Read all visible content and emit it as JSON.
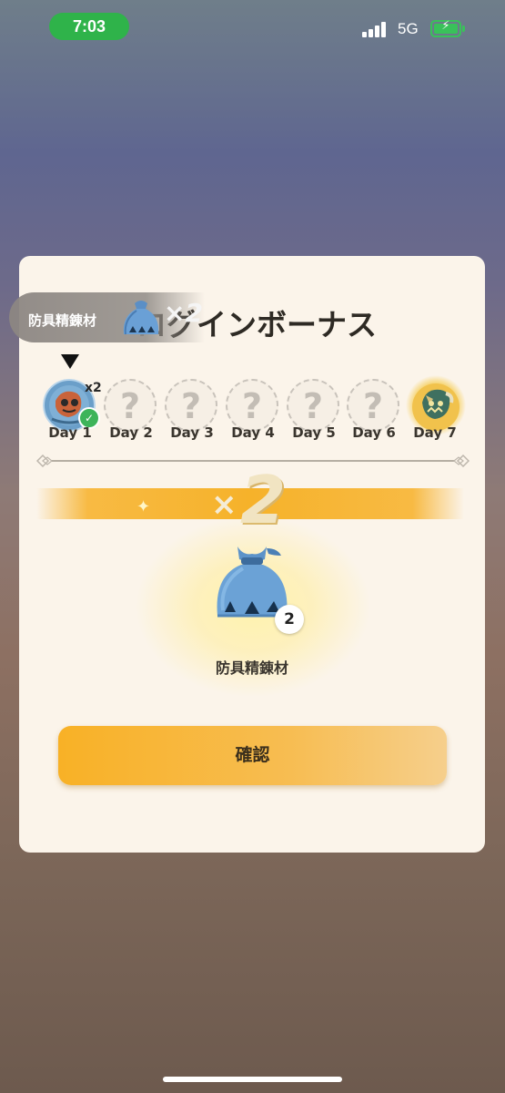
{
  "status_bar": {
    "time": "7:03",
    "network": "5G",
    "battery_icon": "battery-charging-icon"
  },
  "modal": {
    "title": "ログインボーナス",
    "toast": {
      "item_name": "防具精錬材",
      "multiplier": "×2"
    },
    "days": [
      {
        "label": "Day 1",
        "state": "claimed",
        "multiplier": "x2"
      },
      {
        "label": "Day 2",
        "state": "unknown",
        "mark": "?"
      },
      {
        "label": "Day 3",
        "state": "unknown",
        "mark": "?"
      },
      {
        "label": "Day 4",
        "state": "unknown",
        "mark": "?"
      },
      {
        "label": "Day 5",
        "state": "unknown",
        "mark": "?"
      },
      {
        "label": "Day 6",
        "state": "unknown",
        "mark": "?"
      },
      {
        "label": "Day 7",
        "state": "special"
      }
    ],
    "reward": {
      "multiplier_x": "×",
      "multiplier_n": "2",
      "item_name": "防具精錬材",
      "count": "2"
    },
    "confirm_label": "確認"
  },
  "colors": {
    "accent": "#f6b22a",
    "modal_bg": "#fbf4ea",
    "claimed_badge": "#3db45a"
  }
}
